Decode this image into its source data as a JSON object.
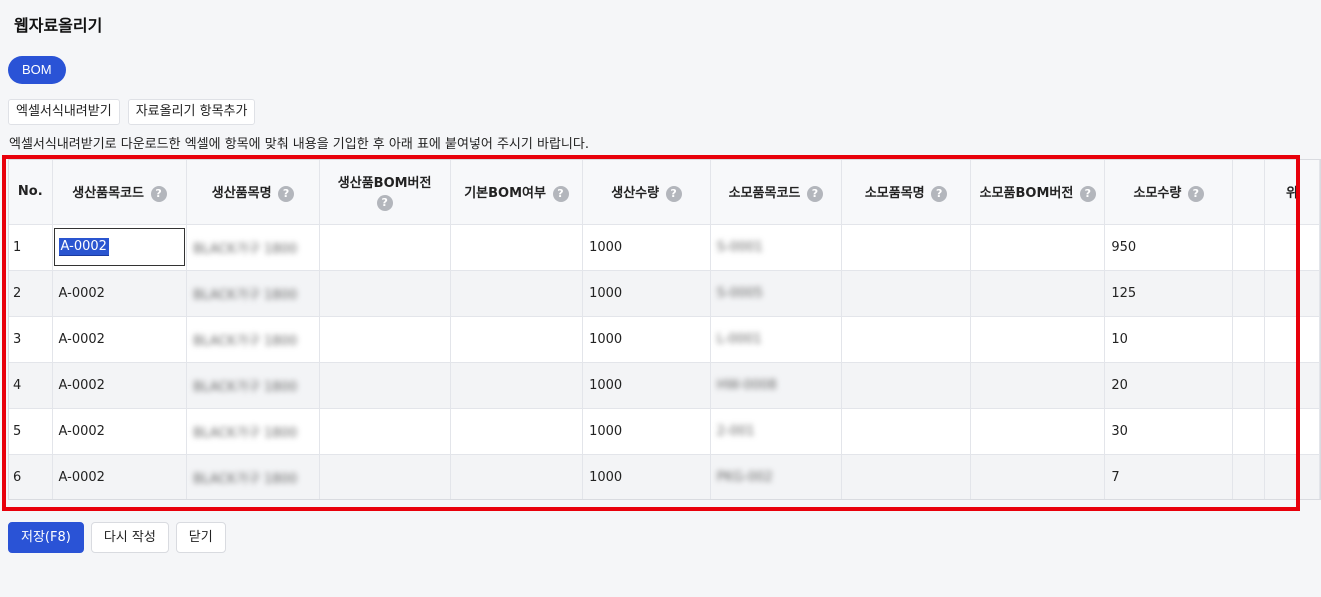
{
  "page": {
    "title": "웹자료올리기"
  },
  "tabs": {
    "active_label": "BOM"
  },
  "toolbar": {
    "download_template_label": "엑셀서식내려받기",
    "add_field_label": "자료올리기 항목추가"
  },
  "guide_text": "엑셀서식내려받기로 다운로드한 엑셀에 항목에 맞춰 내용을 기입한 후 아래 표에 붙여넣어 주시기 바랍니다.",
  "table": {
    "columns": [
      {
        "label": "No.",
        "help": false
      },
      {
        "label": "생산품목코드",
        "help": true
      },
      {
        "label": "생산품목명",
        "help": true
      },
      {
        "label": "생산품BOM버전",
        "help": true
      },
      {
        "label": "기본BOM여부",
        "help": true
      },
      {
        "label": "생산수량",
        "help": true
      },
      {
        "label": "소모품목코드",
        "help": true
      },
      {
        "label": "소모품목명",
        "help": true
      },
      {
        "label": "소모품BOM버전",
        "help": true
      },
      {
        "label": "소모수량",
        "help": true
      },
      {
        "label": "",
        "help": false
      },
      {
        "label": "위",
        "help": false
      }
    ],
    "rows": [
      {
        "no": "1",
        "prod_code": "A-0002",
        "prod_name": "BLACK가구 1800",
        "prod_bom_ver": "",
        "default_bom": "",
        "prod_qty": "1000",
        "cons_code": "S-0001",
        "cons_name": "",
        "cons_bom_ver": "",
        "cons_qty": "950"
      },
      {
        "no": "2",
        "prod_code": "A-0002",
        "prod_name": "BLACK가구 1800",
        "prod_bom_ver": "",
        "default_bom": "",
        "prod_qty": "1000",
        "cons_code": "S-0005",
        "cons_name": "",
        "cons_bom_ver": "",
        "cons_qty": "125"
      },
      {
        "no": "3",
        "prod_code": "A-0002",
        "prod_name": "BLACK가구 1800",
        "prod_bom_ver": "",
        "default_bom": "",
        "prod_qty": "1000",
        "cons_code": "L-0001",
        "cons_name": "",
        "cons_bom_ver": "",
        "cons_qty": "10"
      },
      {
        "no": "4",
        "prod_code": "A-0002",
        "prod_name": "BLACK가구 1800",
        "prod_bom_ver": "",
        "default_bom": "",
        "prod_qty": "1000",
        "cons_code": "HW-0008",
        "cons_name": "",
        "cons_bom_ver": "",
        "cons_qty": "20"
      },
      {
        "no": "5",
        "prod_code": "A-0002",
        "prod_name": "BLACK가구 1800",
        "prod_bom_ver": "",
        "default_bom": "",
        "prod_qty": "1000",
        "cons_code": "2-001",
        "cons_name": "",
        "cons_bom_ver": "",
        "cons_qty": "30"
      },
      {
        "no": "6",
        "prod_code": "A-0002",
        "prod_name": "BLACK가구 1800",
        "prod_bom_ver": "",
        "default_bom": "",
        "prod_qty": "1000",
        "cons_code": "PKG-002",
        "cons_name": "",
        "cons_bom_ver": "",
        "cons_qty": "7"
      }
    ]
  },
  "footer": {
    "save_label": "저장(F8)",
    "rewrite_label": "다시 작성",
    "close_label": "닫기"
  },
  "colors": {
    "accent": "#2a53d6",
    "highlight": "#e8000b"
  }
}
